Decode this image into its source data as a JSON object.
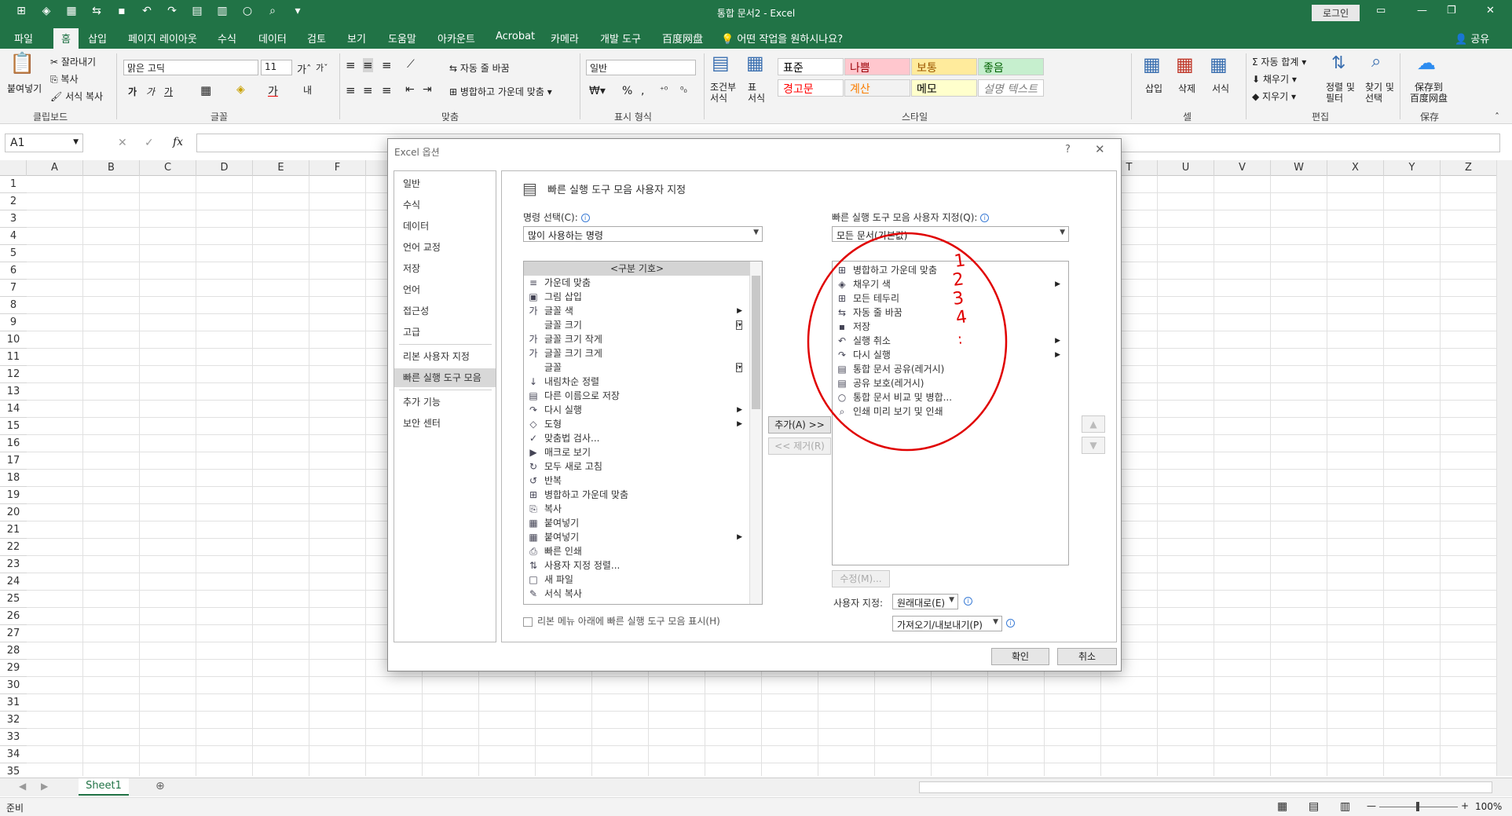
{
  "window": {
    "title": "통합 문서2  -  Excel",
    "login_label": "로그인"
  },
  "ribbon_tabs": [
    "파일",
    "홈",
    "삽입",
    "페이지 레이아웃",
    "수식",
    "데이터",
    "검토",
    "보기",
    "도움말",
    "아카운트",
    "Acrobat",
    "카메라",
    "개발 도구",
    "百度网盘"
  ],
  "tell_me": "어떤 작업을 원하시나요?",
  "share_label": "공유",
  "ribbon": {
    "clipboard": {
      "paste": "붙여넣기",
      "cut": "잘라내기",
      "copy": "복사",
      "format_painter": "서식 복사",
      "label": "클립보드"
    },
    "font": {
      "name": "맑은 고딕",
      "size": "11",
      "label": "글꼴"
    },
    "alignment": {
      "wrap": "자동 줄 바꿈",
      "merge": "병합하고 가운데 맞춤",
      "label": "맞춤"
    },
    "number": {
      "format": "일반",
      "label": "표시 형식"
    },
    "styles": {
      "conditional": "조건부\n서식",
      "table": "표\n서식",
      "cells": [
        {
          "label": "표준",
          "color": "#000000",
          "bg": "#ffffff"
        },
        {
          "label": "나쁨",
          "color": "#9c0006",
          "bg": "#ffc7ce"
        },
        {
          "label": "보통",
          "color": "#9c5700",
          "bg": "#ffeb9c"
        },
        {
          "label": "좋음",
          "color": "#006100",
          "bg": "#c6efce"
        },
        {
          "label": "경고문",
          "color": "#ff0000",
          "bg": "#ffffff"
        },
        {
          "label": "계산",
          "color": "#fa7d00",
          "bg": "#f2f2f2"
        },
        {
          "label": "메모",
          "color": "#000000",
          "bg": "#ffffcc"
        },
        {
          "label": "설명 텍스트",
          "color": "#7f7f7f",
          "bg": "#ffffff"
        }
      ],
      "label": "스타일"
    },
    "cells": {
      "insert": "삽입",
      "delete": "삭제",
      "format": "서식",
      "label": "셀"
    },
    "editing": {
      "autosum": "자동 합계",
      "fill": "채우기",
      "clear": "지우기",
      "sort": "정렬 및\n필터",
      "find": "찾기 및\n선택",
      "label": "편집"
    },
    "save": {
      "save_to": "保存到\n百度网盘",
      "label": "保存"
    }
  },
  "formula_bar": {
    "name_box": "A1",
    "fx": "fx"
  },
  "columns": [
    "A",
    "B",
    "C",
    "D",
    "E",
    "F",
    "G",
    "H",
    "I",
    "J",
    "K",
    "L",
    "M",
    "N",
    "O",
    "P",
    "Q",
    "R",
    "S",
    "T",
    "U",
    "V",
    "W",
    "X",
    "Y",
    "Z"
  ],
  "rows": [
    "1",
    "2",
    "3",
    "4",
    "5",
    "6",
    "7",
    "8",
    "9",
    "10",
    "11",
    "12",
    "13",
    "14",
    "15",
    "16",
    "17",
    "18",
    "19",
    "20",
    "21",
    "22",
    "23",
    "24",
    "25",
    "26",
    "27",
    "28",
    "29",
    "30",
    "31",
    "32",
    "33",
    "34",
    "35"
  ],
  "sheet_tab": "Sheet1",
  "status": {
    "ready": "준비",
    "zoom": "100%"
  },
  "dialog": {
    "title": "Excel 옵션",
    "help": "?",
    "nav": [
      "일반",
      "수식",
      "데이터",
      "언어 교정",
      "저장",
      "언어",
      "접근성",
      "고급",
      "리본 사용자 지정",
      "빠른 실행 도구 모음",
      "추가 기능",
      "보안 센터"
    ],
    "heading": "빠른 실행 도구 모음 사용자 지정",
    "choose_label": "명령 선택(C):",
    "choose_value": "많이 사용하는 명령",
    "customize_label": "빠른 실행 도구 모음 사용자 지정(Q):",
    "customize_value": "모든 문서(기본값)",
    "commands": [
      {
        "label": "<구분 기호>",
        "icon": ""
      },
      {
        "label": "가운데 맞춤",
        "icon": "≡"
      },
      {
        "label": "그림 삽입",
        "icon": "▣"
      },
      {
        "label": "글꼴 색",
        "icon": "가"
      },
      {
        "label": "글꼴 크기",
        "icon": ""
      },
      {
        "label": "글꼴 크기 작게",
        "icon": "가"
      },
      {
        "label": "글꼴 크기 크게",
        "icon": "가"
      },
      {
        "label": "글꼴",
        "icon": ""
      },
      {
        "label": "내림차순 정렬",
        "icon": "↓"
      },
      {
        "label": "다른 이름으로 저장",
        "icon": "▤"
      },
      {
        "label": "다시 실행",
        "icon": "↷"
      },
      {
        "label": "도형",
        "icon": "◇"
      },
      {
        "label": "맞춤법 검사...",
        "icon": "✓"
      },
      {
        "label": "매크로 보기",
        "icon": "▶"
      },
      {
        "label": "모두 새로 고침",
        "icon": "↻"
      },
      {
        "label": "반복",
        "icon": "↺"
      },
      {
        "label": "병합하고 가운데 맞춤",
        "icon": "⊞"
      },
      {
        "label": "복사",
        "icon": "⎘"
      },
      {
        "label": "붙여넣기",
        "icon": "▦"
      },
      {
        "label": "붙여넣기",
        "icon": "▦"
      },
      {
        "label": "빠른 인쇄",
        "icon": "⎙"
      },
      {
        "label": "사용자 지정 정렬...",
        "icon": "⇅"
      },
      {
        "label": "새 파일",
        "icon": "□"
      },
      {
        "label": "서식 복사",
        "icon": "✎"
      }
    ],
    "qat_items": [
      {
        "label": "병합하고 가운데 맞춤",
        "icon": "⊞"
      },
      {
        "label": "채우기 색",
        "icon": "◈"
      },
      {
        "label": "모든 테두리",
        "icon": "⊞"
      },
      {
        "label": "자동 줄 바꿈",
        "icon": "⇆"
      },
      {
        "label": "저장",
        "icon": "▪"
      },
      {
        "label": "실행 취소",
        "icon": "↶"
      },
      {
        "label": "다시 실행",
        "icon": "↷"
      },
      {
        "label": "통합 문서 공유(레거시)",
        "icon": "▤"
      },
      {
        "label": "공유 보호(레거시)",
        "icon": "▤"
      },
      {
        "label": "통합 문서 비교 및 병합...",
        "icon": "○"
      },
      {
        "label": "인쇄 미리 보기 및 인쇄",
        "icon": "⌕"
      }
    ],
    "add_button": "추가(A) >>",
    "remove_button": "<< 제거(R)",
    "modify_button": "수정(M)...",
    "show_below_label": "리본 메뉴 아래에 빠른 실행 도구 모음 표시(H)",
    "customizations_label": "사용자 지정:",
    "reset_button": "원래대로(E)",
    "import_export_button": "가져오기/내보내기(P)",
    "ok_button": "확인",
    "cancel_button": "취소"
  },
  "annotation": {
    "numbers": [
      "1",
      "2",
      "3",
      "4",
      ":"
    ],
    "color": "#e00000"
  }
}
